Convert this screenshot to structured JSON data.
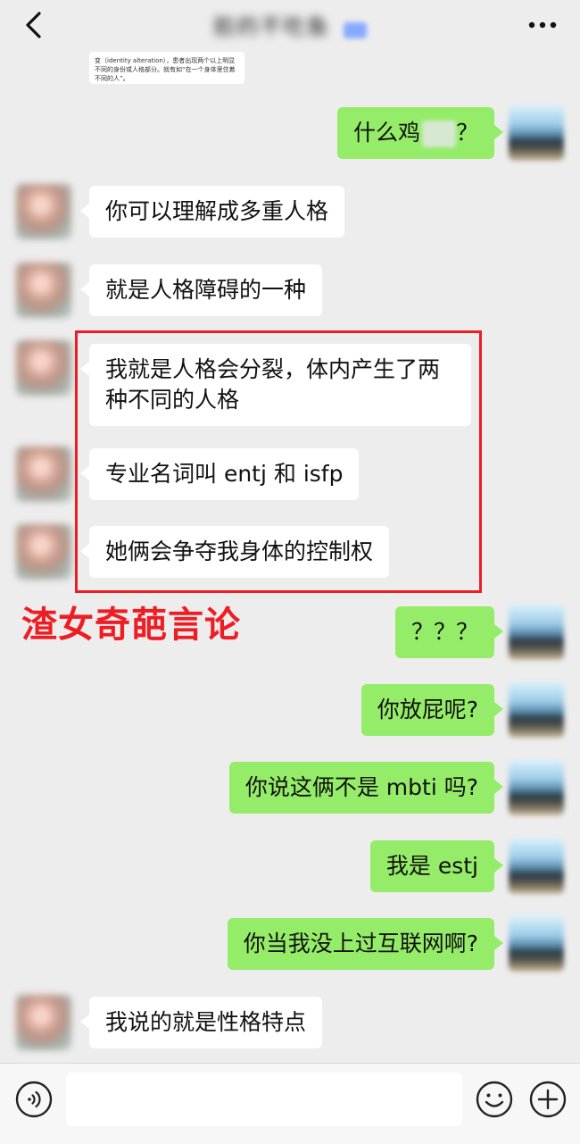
{
  "header": {
    "title": "脸的不吃鱼",
    "back_icon": "chevron-left-icon",
    "more_icon": "more-dots-icon"
  },
  "quote_card": {
    "text": "变（identity alteration），患者出现两个以上明显不同的身份或人格部分。就有如“在一个身体里住着不同的人”。"
  },
  "annotation": {
    "label": "渣女奇葩言论",
    "color": "#ee1d24"
  },
  "messages": [
    {
      "side": "right",
      "text": "什么鸡",
      "suffix": "？"
    },
    {
      "side": "left",
      "text": "你可以理解成多重人格"
    },
    {
      "side": "left",
      "text": "就是人格障碍的一种"
    },
    {
      "side": "left",
      "text": "我就是人格会分裂，体内产生了两种不同的人格"
    },
    {
      "side": "left",
      "text": "专业名词叫 entj 和 isfp"
    },
    {
      "side": "left",
      "text": "她俩会争夺我身体的控制权"
    },
    {
      "side": "right",
      "text": "？？？"
    },
    {
      "side": "right",
      "text": "你放屁呢?"
    },
    {
      "side": "right",
      "text": "你说这俩不是 mbti 吗?"
    },
    {
      "side": "right",
      "text": "我是 estj"
    },
    {
      "side": "right",
      "text": "你当我没上过互联网啊?"
    },
    {
      "side": "left",
      "text": "我说的就是性格特点"
    }
  ],
  "input_bar": {
    "voice_icon": "voice-icon",
    "emoji_icon": "emoji-icon",
    "plus_icon": "plus-icon"
  },
  "colors": {
    "background": "#ededed",
    "own_bubble": "#95ec69",
    "other_bubble": "#ffffff",
    "annotation_red": "#ee1d24"
  }
}
